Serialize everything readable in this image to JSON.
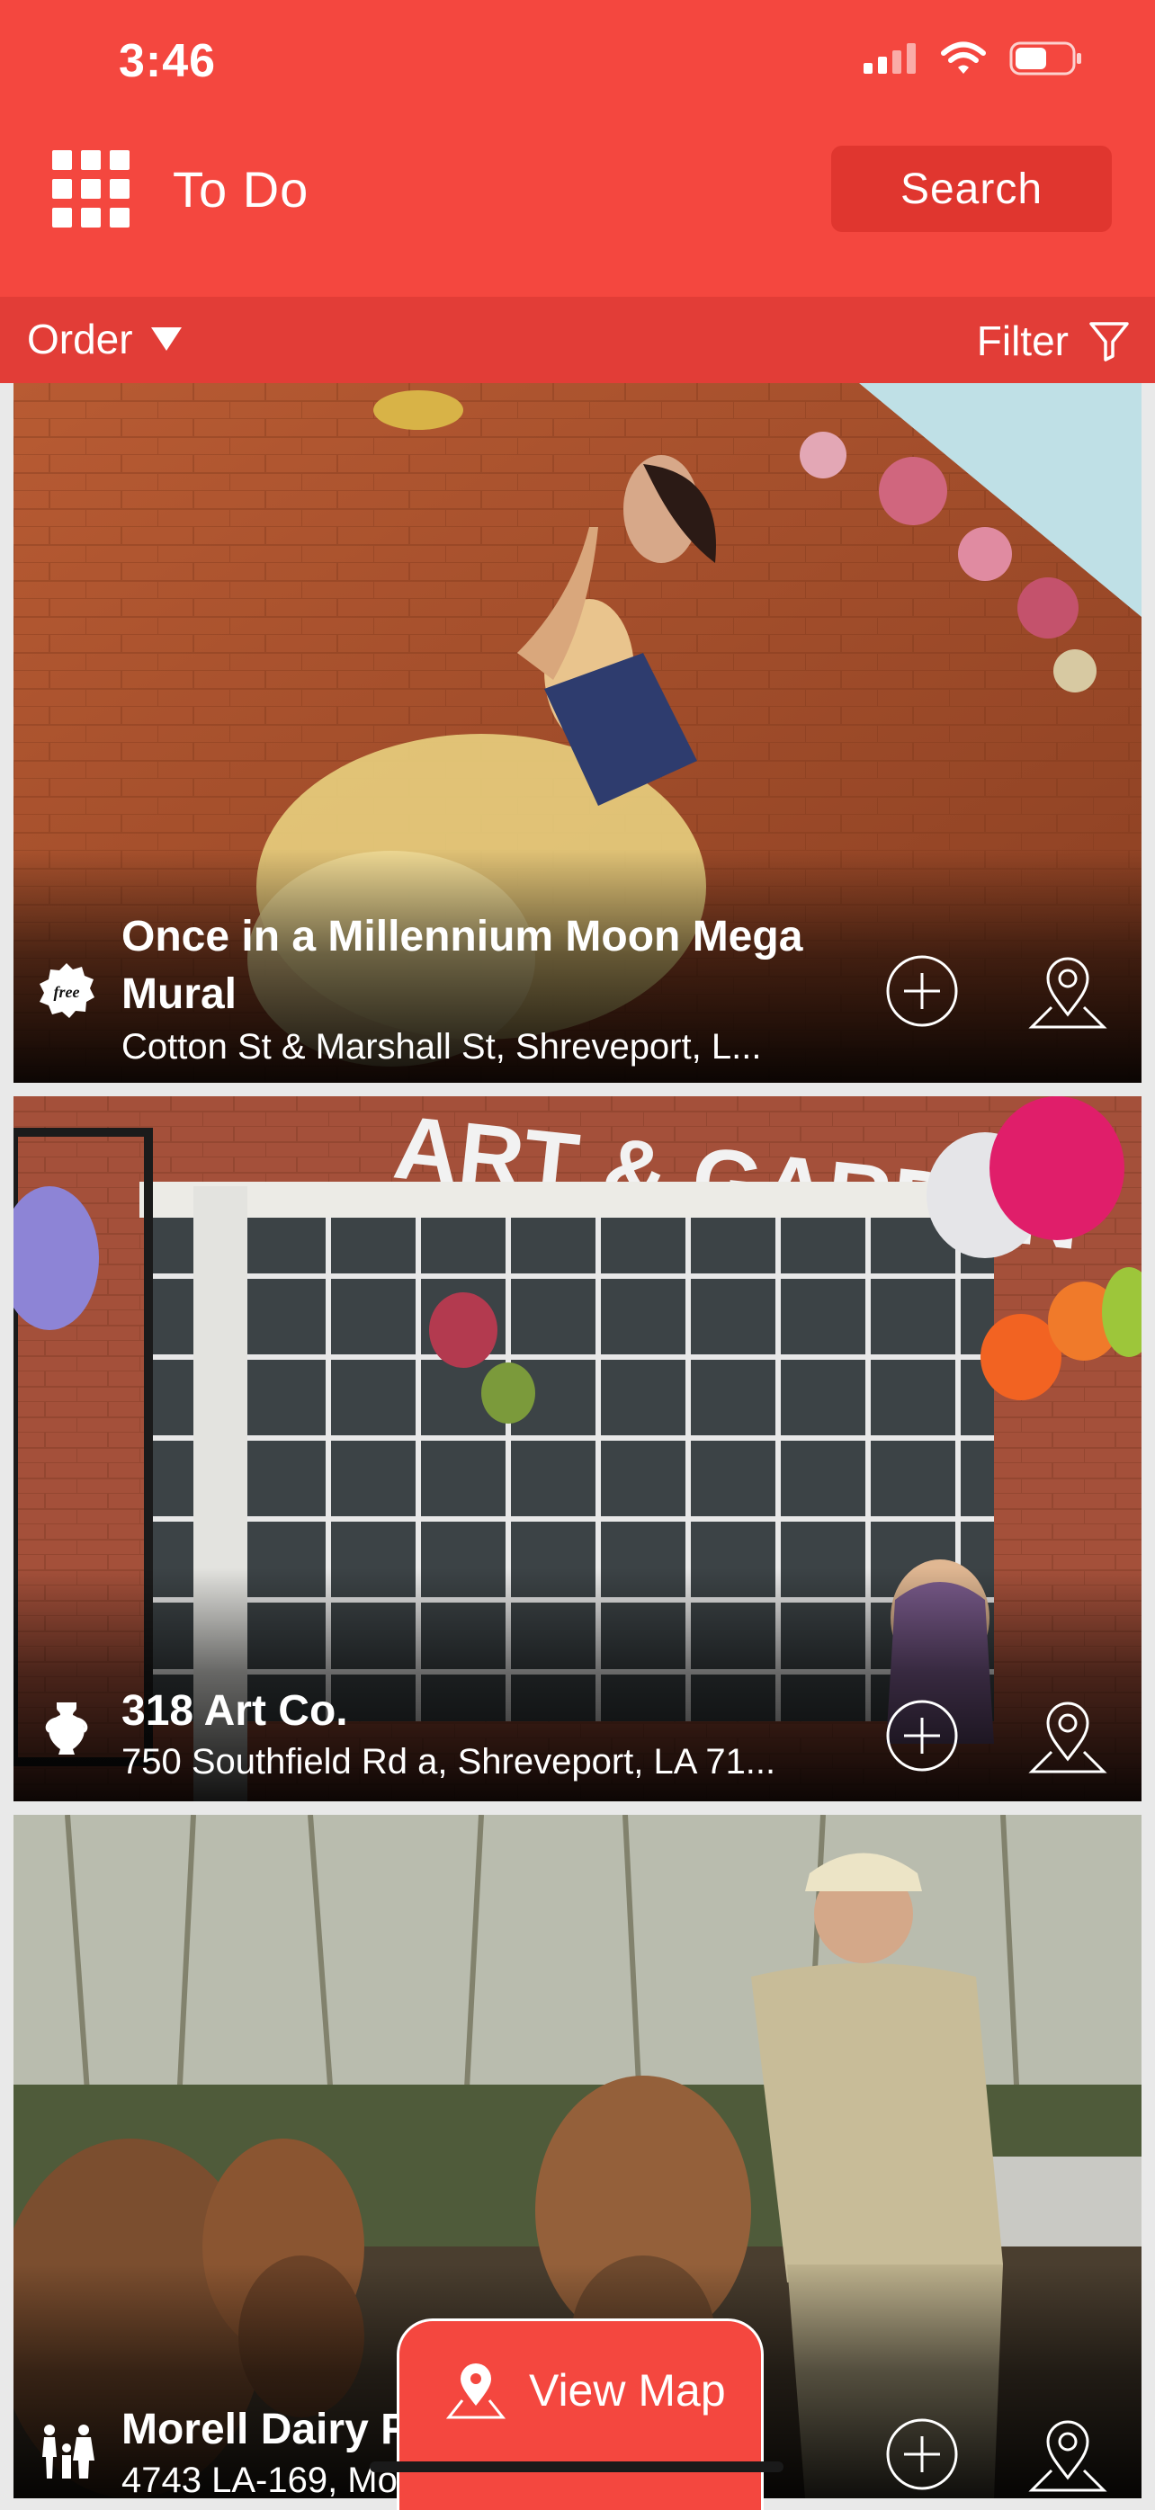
{
  "status_bar": {
    "time": "3:46",
    "icons": [
      "signal-icon",
      "wifi-icon",
      "battery-icon"
    ]
  },
  "header": {
    "menu_icon": "grid-icon",
    "title": "To Do",
    "search_label": "Search"
  },
  "toolbar": {
    "order_label": "Order",
    "filter_label": "Filter"
  },
  "listings": [
    {
      "name": "Once in a Millennium Moon Mega Mural",
      "address": "Cotton St & Marshall St, Shreveport, L...",
      "category_icon": "free-badge-icon"
    },
    {
      "name": "318 Art Co.",
      "address": "750 Southfield Rd a, Shreveport, LA 71...",
      "category_icon": "vase-icon"
    },
    {
      "name": "Morell Dairy F",
      "address": "4743 LA-169, Mo",
      "category_icon": "family-icon"
    }
  ],
  "view_map_label": "View Map",
  "colors": {
    "brand": "#f4473f",
    "toolbar": "#e23d37",
    "search_button": "#e0362f"
  }
}
